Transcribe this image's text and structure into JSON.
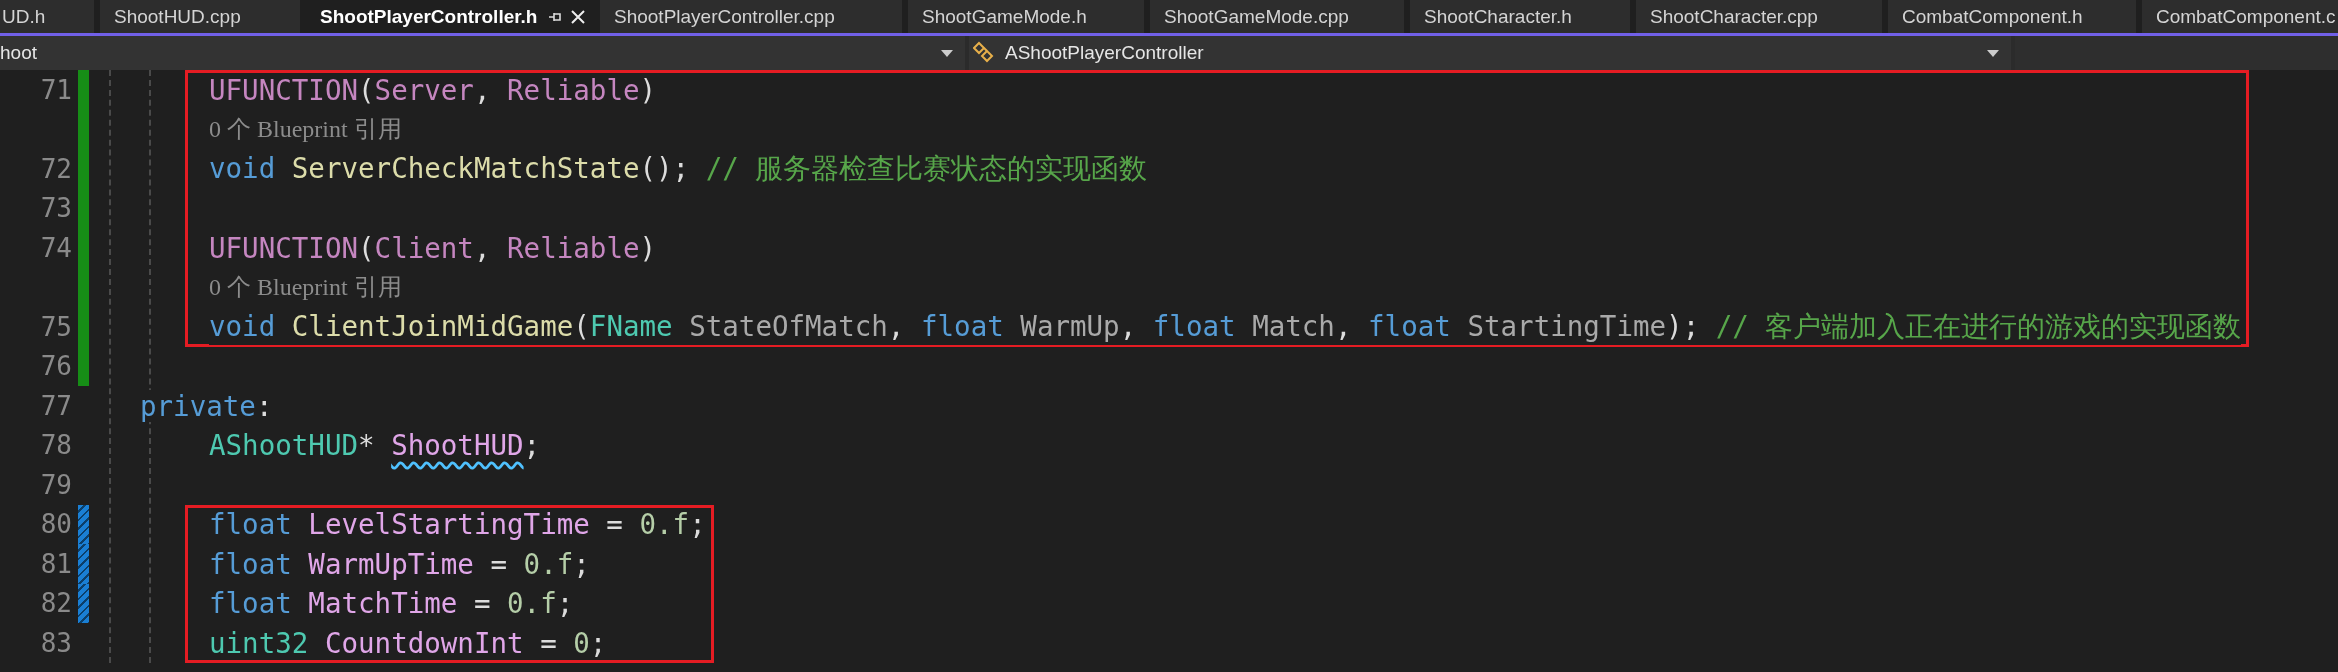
{
  "tabs": [
    {
      "label": "UD.h",
      "selected": false,
      "pinned": false
    },
    {
      "label": "ShootHUD.cpp",
      "selected": false,
      "pinned": false
    },
    {
      "label": "ShootPlayerController.h",
      "selected": true,
      "pinned": true
    },
    {
      "label": "ShootPlayerController.cpp",
      "selected": false,
      "pinned": false
    },
    {
      "label": "ShootGameMode.h",
      "selected": false,
      "pinned": false
    },
    {
      "label": "ShootGameMode.cpp",
      "selected": false,
      "pinned": false
    },
    {
      "label": "ShootCharacter.h",
      "selected": false,
      "pinned": false
    },
    {
      "label": "ShootCharacter.cpp",
      "selected": false,
      "pinned": false
    },
    {
      "label": "CombatComponent.h",
      "selected": false,
      "pinned": false
    },
    {
      "label": "CombatComponent.c",
      "selected": false,
      "pinned": false
    }
  ],
  "navigation": {
    "project": "hoot",
    "scope": "AShootPlayerController"
  },
  "blocks": [
    {
      "highlighted": true,
      "lines": [
        {
          "kind": "code",
          "number": "71",
          "modified": true,
          "saved": true,
          "tokens": [
            {
              "text": "UFUNCTION",
              "kind": "macro"
            },
            {
              "text": "(",
              "kind": "punct"
            },
            {
              "text": "Server",
              "kind": "macro"
            },
            {
              "text": ", ",
              "kind": "punct"
            },
            {
              "text": "Reliable",
              "kind": "macro"
            },
            {
              "text": ")",
              "kind": "punct"
            }
          ]
        },
        {
          "kind": "lens",
          "modified": true,
          "saved": true,
          "text": "0 个 Blueprint 引用"
        },
        {
          "kind": "code",
          "number": "72",
          "modified": true,
          "saved": true,
          "tokens": [
            {
              "text": "void ",
              "kind": "keyword"
            },
            {
              "text": "ServerCheckMatchState",
              "kind": "function"
            },
            {
              "text": "(); ",
              "kind": "punct"
            },
            {
              "text": "// 服务器检查比赛状态的实现函数",
              "kind": "comment"
            }
          ]
        },
        {
          "kind": "blank",
          "number": "73",
          "modified": true,
          "saved": true
        },
        {
          "kind": "code",
          "number": "74",
          "modified": true,
          "saved": true,
          "tokens": [
            {
              "text": "UFUNCTION",
              "kind": "macro"
            },
            {
              "text": "(",
              "kind": "punct"
            },
            {
              "text": "Client",
              "kind": "macro"
            },
            {
              "text": ", ",
              "kind": "punct"
            },
            {
              "text": "Reliable",
              "kind": "macro"
            },
            {
              "text": ")",
              "kind": "punct"
            }
          ]
        },
        {
          "kind": "lens",
          "modified": true,
          "saved": true,
          "text": "0 个 Blueprint 引用"
        },
        {
          "kind": "code",
          "number": "75",
          "modified": true,
          "saved": true,
          "tokens": [
            {
              "text": "void ",
              "kind": "keyword"
            },
            {
              "text": "ClientJoinMidGame",
              "kind": "function"
            },
            {
              "text": "(",
              "kind": "punct"
            },
            {
              "text": "FName ",
              "kind": "type"
            },
            {
              "text": "StateOfMatch",
              "kind": "param"
            },
            {
              "text": ", ",
              "kind": "punct"
            },
            {
              "text": "float ",
              "kind": "keyword"
            },
            {
              "text": "WarmUp",
              "kind": "param"
            },
            {
              "text": ", ",
              "kind": "punct"
            },
            {
              "text": "float ",
              "kind": "keyword"
            },
            {
              "text": "Match",
              "kind": "param"
            },
            {
              "text": ", ",
              "kind": "punct"
            },
            {
              "text": "float ",
              "kind": "keyword"
            },
            {
              "text": "StartingTime",
              "kind": "param"
            },
            {
              "text": "); ",
              "kind": "punct"
            },
            {
              "text": "// 客户端加入正在进行的游戏的实现函数",
              "kind": "comment"
            }
          ]
        }
      ]
    },
    {
      "highlighted": false,
      "lines": [
        {
          "kind": "blank",
          "number": "76",
          "modified": true,
          "saved": true
        },
        {
          "kind": "access",
          "number": "77",
          "modified": false,
          "tokens": [
            {
              "text": "private",
              "kind": "keyword"
            },
            {
              "text": ":",
              "kind": "punct"
            }
          ]
        },
        {
          "kind": "code",
          "number": "78",
          "modified": false,
          "tokens": [
            {
              "text": "AShootHUD",
              "kind": "type"
            },
            {
              "text": "* ",
              "kind": "punct"
            },
            {
              "text": "ShootHUD",
              "kind": "member",
              "squiggle": true
            },
            {
              "text": ";",
              "kind": "punct"
            }
          ]
        },
        {
          "kind": "blank",
          "number": "79",
          "modified": false
        }
      ]
    },
    {
      "highlighted": true,
      "lines": [
        {
          "kind": "code",
          "number": "80",
          "modified": true,
          "saved": false,
          "tokens": [
            {
              "text": "float ",
              "kind": "keyword"
            },
            {
              "text": "LevelStartingTime",
              "kind": "member"
            },
            {
              "text": " = ",
              "kind": "punct"
            },
            {
              "text": "0.f",
              "kind": "number"
            },
            {
              "text": ";",
              "kind": "punct"
            }
          ]
        },
        {
          "kind": "code",
          "number": "81",
          "modified": true,
          "saved": false,
          "tokens": [
            {
              "text": "float ",
              "kind": "keyword"
            },
            {
              "text": "WarmUpTime",
              "kind": "member"
            },
            {
              "text": " = ",
              "kind": "punct"
            },
            {
              "text": "0.f",
              "kind": "number"
            },
            {
              "text": ";",
              "kind": "punct"
            }
          ]
        },
        {
          "kind": "code",
          "number": "82",
          "modified": true,
          "saved": false,
          "tokens": [
            {
              "text": "float ",
              "kind": "keyword"
            },
            {
              "text": "MatchTime",
              "kind": "member"
            },
            {
              "text": " = ",
              "kind": "punct"
            },
            {
              "text": "0.f",
              "kind": "number"
            },
            {
              "text": ";",
              "kind": "punct"
            }
          ]
        },
        {
          "kind": "code",
          "number": "83",
          "modified": false,
          "tokens": [
            {
              "text": "uint32 ",
              "kind": "type"
            },
            {
              "text": "CountdownInt",
              "kind": "member"
            },
            {
              "text": " = ",
              "kind": "punct"
            },
            {
              "text": "0",
              "kind": "number"
            },
            {
              "text": ";",
              "kind": "punct"
            }
          ]
        }
      ]
    }
  ]
}
